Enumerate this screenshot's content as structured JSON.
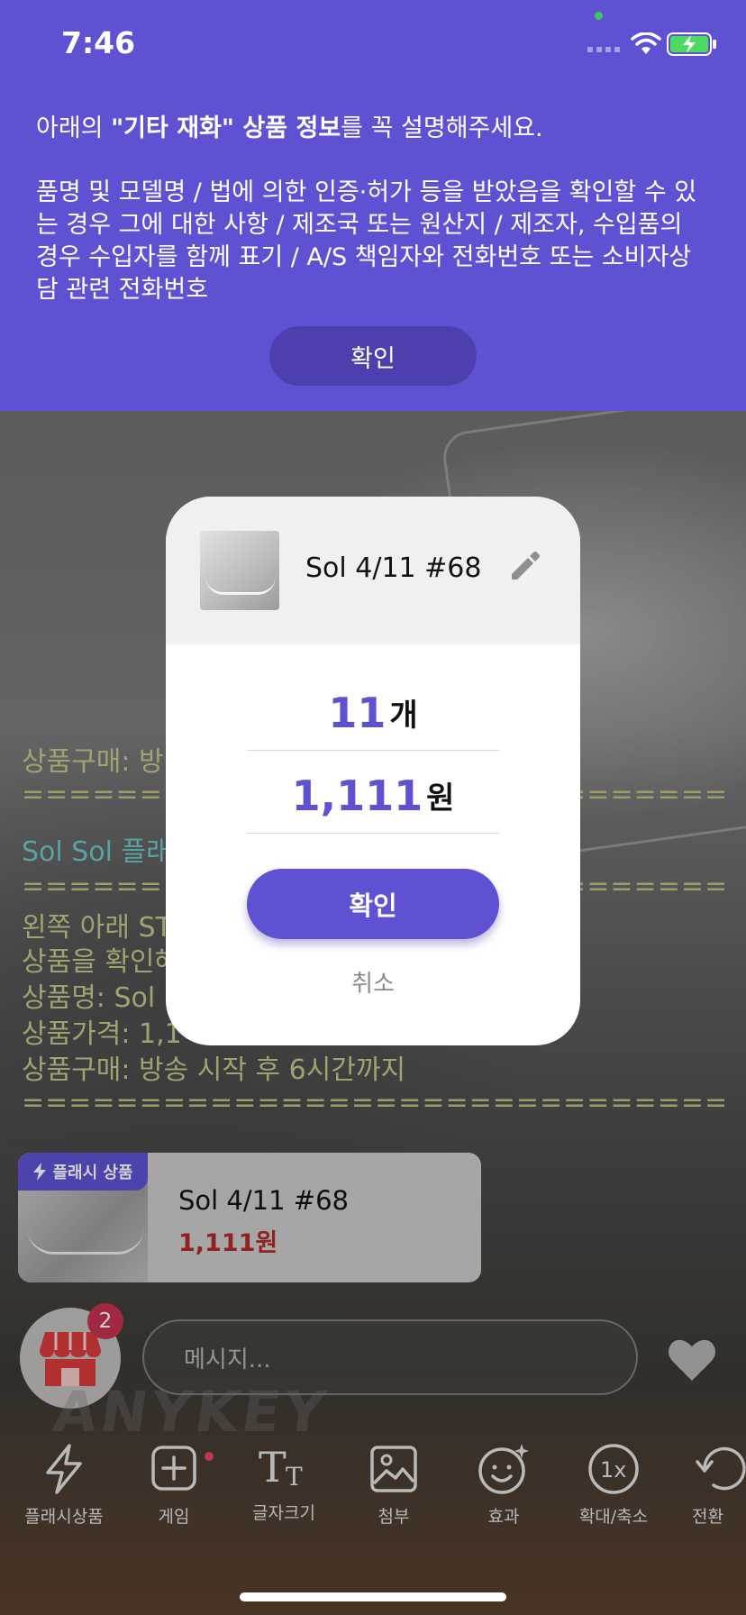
{
  "status": {
    "time": "7:46"
  },
  "banner": {
    "intro_prefix": "아래의 ",
    "intro_bold": "\"기타 재화\" 상품 정보",
    "intro_suffix": "를 꼭 설명해주세요.",
    "description": "품명 및 모델명 / 법에 의한 인증·허가 등을 받았음을 확인할 수 있는 경우 그에 대한 사항 / 제조국 또는 원산지 / 제조자, 수입품의 경우 수입자를 함께 표기 / A/S 책임자와 전화번호 또는 소비자상담 관련 전화번호",
    "confirm_label": "확인"
  },
  "chat": {
    "line1": "상품구매: 방",
    "separator": "==============================",
    "title": "Sol Sol 플래",
    "line2": "왼쪽 아래 ST",
    "line3": "상품을 확인해",
    "line4": "상품명: Sol",
    "line5": "상품가격: 1,1",
    "line6": "상품구매: 방송 시작 후 6시간까지"
  },
  "product_card": {
    "badge": "플래시 상품",
    "name": "Sol 4/11 #68",
    "price": "1,111원"
  },
  "modal": {
    "title": "Sol 4/11 #68",
    "quantity": "11",
    "quantity_unit": "개",
    "price": "1,111",
    "price_unit": "원",
    "confirm_label": "확인",
    "cancel_label": "취소"
  },
  "store": {
    "badge_count": "2"
  },
  "message_input": {
    "placeholder": "메시지..."
  },
  "watermark": "ANYKEY",
  "toolbar": [
    {
      "label": "플래시상품",
      "icon": "flash-icon"
    },
    {
      "label": "게임",
      "icon": "plus-box-icon"
    },
    {
      "label": "글자크기",
      "icon": "text-size-icon"
    },
    {
      "label": "첨부",
      "icon": "image-icon"
    },
    {
      "label": "효과",
      "icon": "smiley-sparkle-icon"
    },
    {
      "label": "확대/축소",
      "icon": "zoom-1x-icon"
    },
    {
      "label": "전환",
      "icon": "rotate-icon"
    }
  ],
  "colors": {
    "accent": "#5e52d3",
    "price_red": "#b22a2a",
    "badge_red": "#c3324f"
  }
}
